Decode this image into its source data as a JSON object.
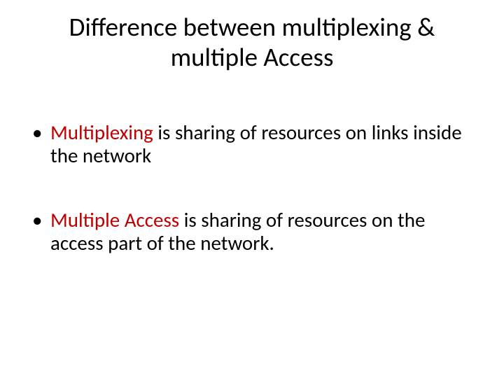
{
  "title": "Difference between multiplexing & multiple Access",
  "bullets": [
    {
      "term": "Multiplexing",
      "rest": " is sharing of resources on links inside the network"
    },
    {
      "term": "Multiple Access",
      "rest": " is sharing of resources on the access part of the network."
    }
  ]
}
